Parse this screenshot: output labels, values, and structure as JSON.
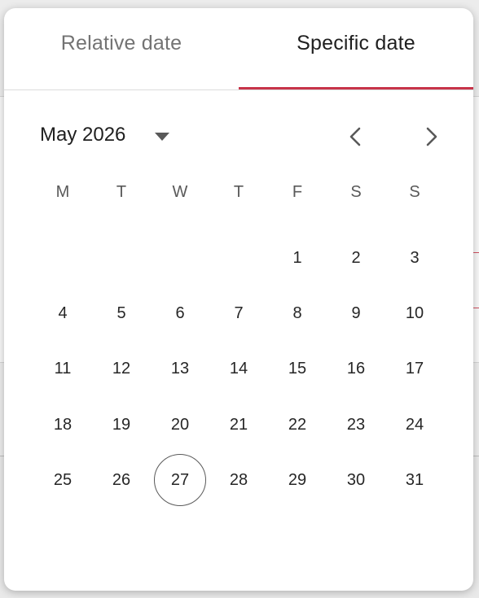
{
  "tabs": {
    "relative_label": "Relative date",
    "specific_label": "Specific date",
    "active": "specific"
  },
  "calendar": {
    "month_label": "May 2026",
    "weekdays": [
      "M",
      "T",
      "W",
      "T",
      "F",
      "S",
      "S"
    ],
    "first_weekday_index": 4,
    "days": [
      "1",
      "2",
      "3",
      "4",
      "5",
      "6",
      "7",
      "8",
      "9",
      "10",
      "11",
      "12",
      "13",
      "14",
      "15",
      "16",
      "17",
      "18",
      "19",
      "20",
      "21",
      "22",
      "23",
      "24",
      "25",
      "26",
      "27",
      "28",
      "29",
      "30",
      "31"
    ],
    "selected_day": "27"
  },
  "icons": {
    "dropdown": "caret-down-icon",
    "prev": "chevron-left-icon",
    "next": "chevron-right-icon"
  },
  "colors": {
    "accent": "#c8344a",
    "text": "#1f1f1f",
    "muted": "#737373"
  }
}
